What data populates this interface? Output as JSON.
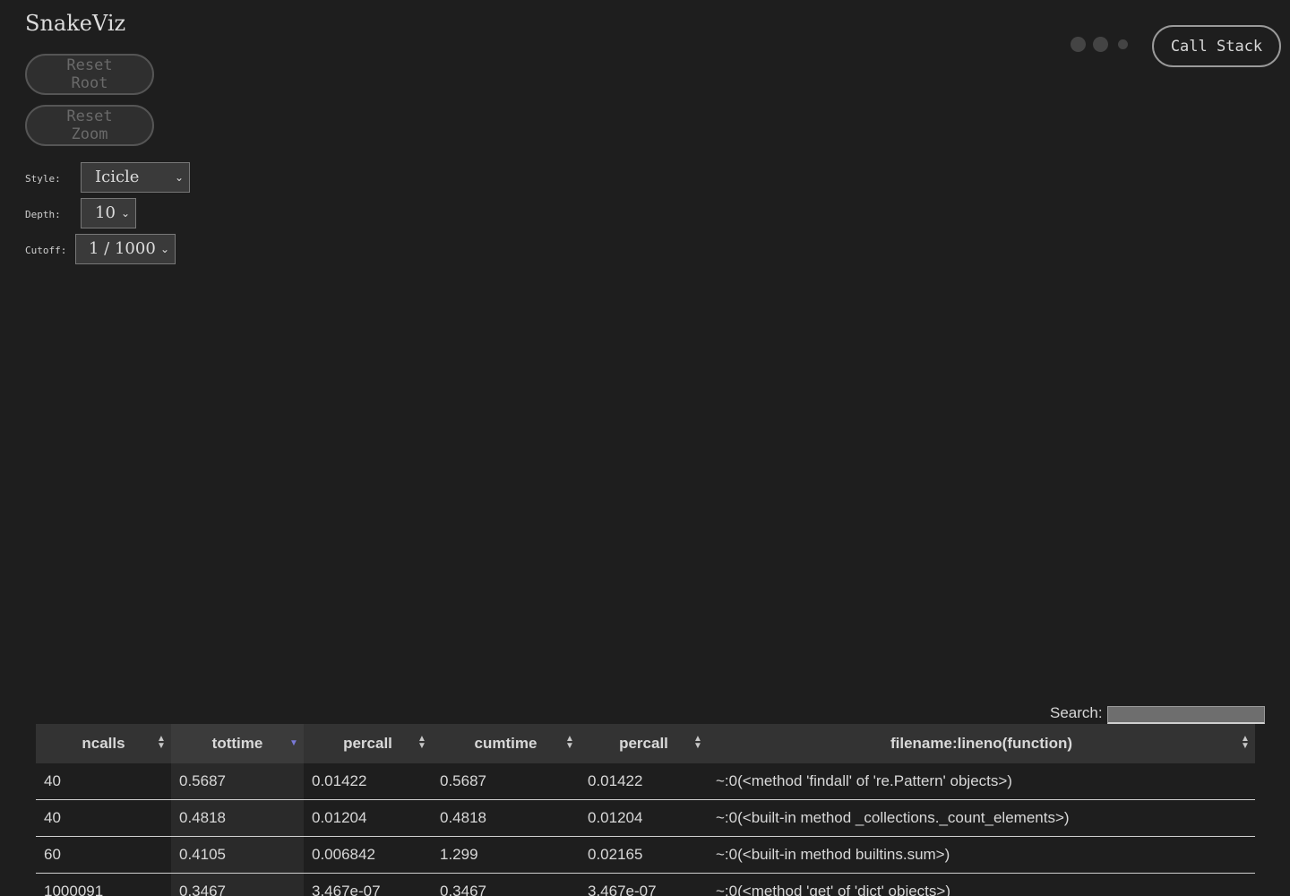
{
  "app": {
    "title": "SnakeViz"
  },
  "controls": {
    "reset_root_label": "Reset Root",
    "reset_zoom_label": "Reset Zoom",
    "call_stack_label": "Call Stack",
    "style": {
      "label": "Style:",
      "value": "Icicle"
    },
    "depth": {
      "label": "Depth:",
      "value": "10"
    },
    "cutoff": {
      "label": "Cutoff:",
      "value": "1 / 1000"
    }
  },
  "search": {
    "label": "Search:",
    "value": ""
  },
  "table": {
    "headers": [
      "ncalls",
      "tottime",
      "percall",
      "cumtime",
      "percall",
      "filename:lineno(function)"
    ],
    "sorted_column": "tottime",
    "sort_direction": "descending",
    "rows": [
      [
        "40",
        "0.5687",
        "0.01422",
        "0.5687",
        "0.01422",
        "~:0(<method 'findall' of 're.Pattern' objects>)"
      ],
      [
        "40",
        "0.4818",
        "0.01204",
        "0.4818",
        "0.01204",
        "~:0(<built-in method _collections._count_elements>)"
      ],
      [
        "60",
        "0.4105",
        "0.006842",
        "1.299",
        "0.02165",
        "~:0(<built-in method builtins.sum>)"
      ],
      [
        "1000091",
        "0.3467",
        "3.467e-07",
        "0.3467",
        "3.467e-07",
        "~:0(<method 'get' of 'dict' objects>)"
      ]
    ]
  },
  "icons": {
    "select_caret": "chevron-down-icon",
    "sort_both": "sort-updown-icon",
    "sort_desc": "sort-desc-icon"
  },
  "colors": {
    "background": "#1e1e1e",
    "sort_accent": "#7a7ad8"
  }
}
